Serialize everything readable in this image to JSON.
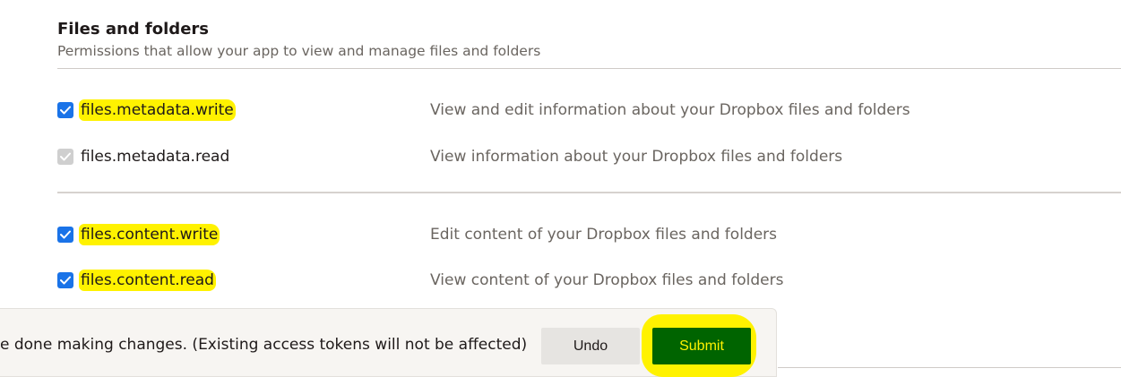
{
  "section": {
    "title": "Files and folders",
    "subtitle": "Permissions that allow your app to view and manage files and folders"
  },
  "permissions": [
    {
      "scope": "files.metadata.write",
      "description": "View and edit information about your Dropbox files and folders",
      "checked": true,
      "disabled": false,
      "highlighted": true
    },
    {
      "scope": "files.metadata.read",
      "description": "View information about your Dropbox files and folders",
      "checked": true,
      "disabled": true,
      "highlighted": false
    },
    {
      "scope": "files.content.write",
      "description": "Edit content of your Dropbox files and folders",
      "checked": true,
      "disabled": false,
      "highlighted": true
    },
    {
      "scope": "files.content.read",
      "description": "View content of your Dropbox files and folders",
      "checked": true,
      "disabled": false,
      "highlighted": true
    }
  ],
  "toast": {
    "message": "e done making changes. (Existing access tokens will not be affected)",
    "undo_label": "Undo",
    "submit_label": "Submit"
  },
  "colors": {
    "checkbox_checked": "#1a73e8",
    "checkbox_disabled": "#cfcfcf",
    "highlight": "#fff200",
    "submit_bg": "#006400"
  },
  "icons": {
    "checkbox": "check-icon"
  }
}
